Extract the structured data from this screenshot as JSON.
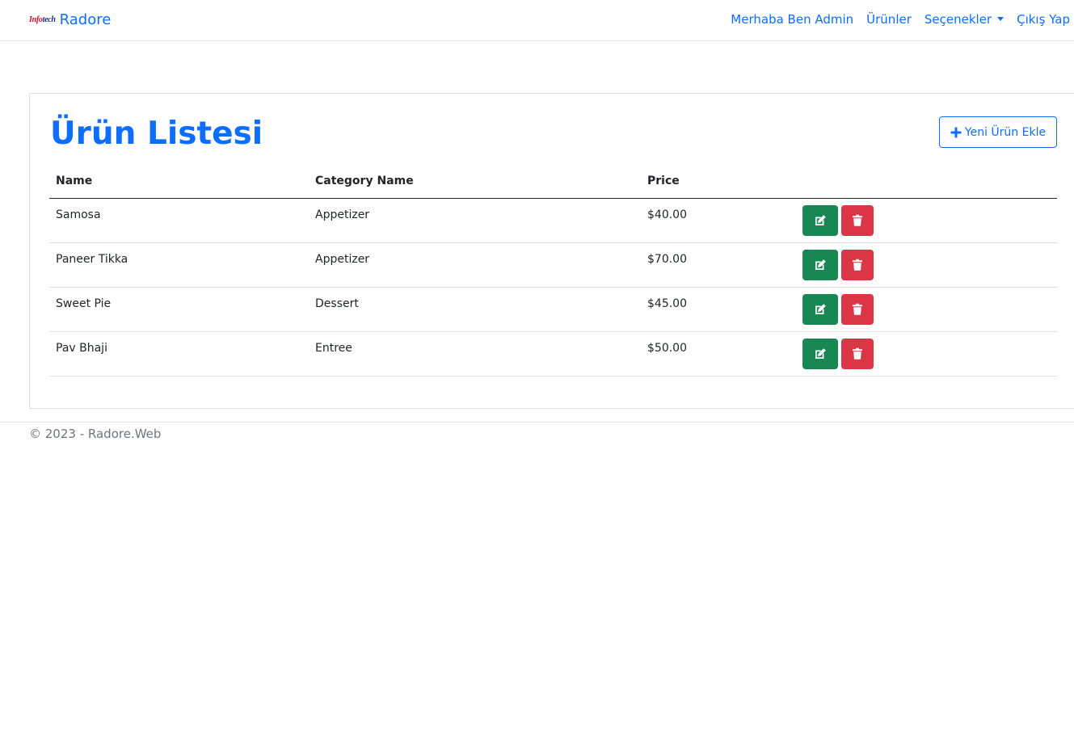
{
  "navbar": {
    "logo_text_part1": "Info",
    "logo_text_part2": "tech",
    "brand": "Radore",
    "links": {
      "greeting": "Merhaba Ben Admin",
      "products": "Ürünler",
      "options": "Seçenekler",
      "logout": "Çıkış Yap"
    },
    "accent_color": "#0d6efd"
  },
  "main": {
    "title": "Ürün Listesi",
    "add_button_label": "Yeni Ürün Ekle",
    "table": {
      "headers": [
        "Name",
        "Category Name",
        "Price"
      ],
      "rows": [
        {
          "name": "Samosa",
          "category": "Appetizer",
          "price": "$40.00"
        },
        {
          "name": "Paneer Tikka",
          "category": "Appetizer",
          "price": "$70.00"
        },
        {
          "name": "Sweet Pie",
          "category": "Dessert",
          "price": "$45.00"
        },
        {
          "name": "Pav Bhaji",
          "category": "Entree",
          "price": "$50.00"
        }
      ],
      "edit_icon": "edit-icon",
      "delete_icon": "trash-icon",
      "edit_color": "#198754",
      "delete_color": "#dc3545"
    }
  },
  "footer": {
    "text": "© 2023 - Radore.Web"
  }
}
